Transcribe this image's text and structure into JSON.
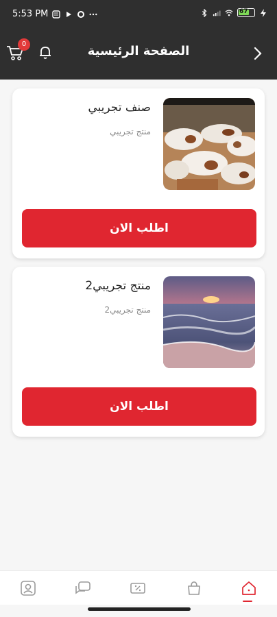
{
  "status_bar": {
    "time": "5:53 PM",
    "left_icons": [
      "notification-icon",
      "play-icon",
      "circle-icon",
      "more-dots-icon"
    ],
    "right_icons": [
      "bluetooth-icon",
      "signal-icon",
      "wifi-icon",
      "battery-icon"
    ],
    "battery": "67"
  },
  "header": {
    "title": "الصفحة الرئيسية",
    "cart_count": "0"
  },
  "products": [
    {
      "name": "صنف تجريبي",
      "description": "منتج تجريبي",
      "button_label": "اطلب الان"
    },
    {
      "name": "منتج تجريبي2",
      "description": "منتج تجريبي2",
      "button_label": "اطلب الان"
    }
  ],
  "bottom_nav": {
    "items": [
      "profile-icon",
      "chat-icon",
      "coupon-icon",
      "bag-icon",
      "home-icon"
    ],
    "active": "home-icon"
  },
  "colors": {
    "header_bg": "#2f2f2f",
    "accent_red": "#e02630",
    "page_bg": "#f6f6f6"
  }
}
